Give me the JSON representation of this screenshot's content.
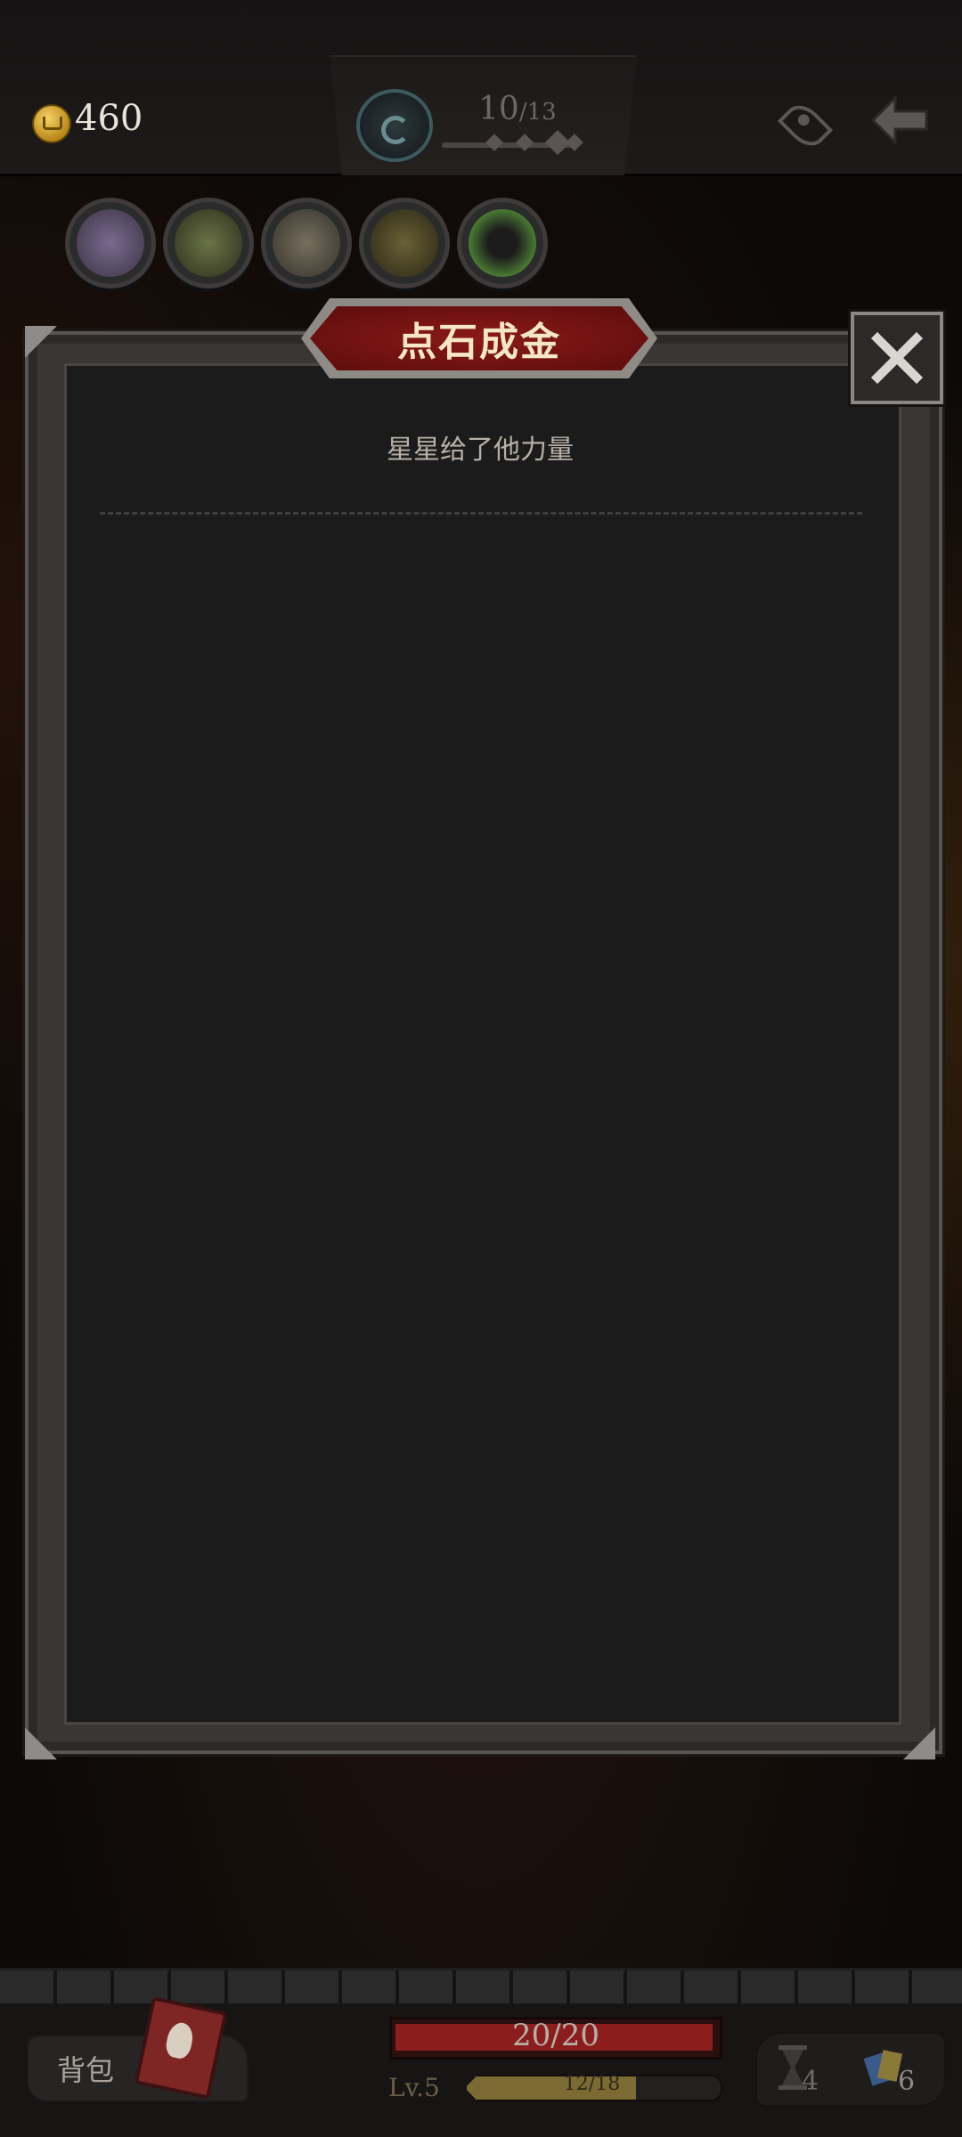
{
  "topbar": {
    "gold": "460",
    "stage_current": "10",
    "stage_total": "/13"
  },
  "relics": [
    {
      "icon": "cactus-relic-icon",
      "color": "#6a5a7a"
    },
    {
      "icon": "cannon-relic-icon",
      "color": "#545d3a"
    },
    {
      "icon": "monster-relic-icon",
      "color": "#5e5a50"
    },
    {
      "icon": "sunflower-relic-icon",
      "color": "#4d4a33"
    },
    {
      "icon": "green-orb-relic-icon",
      "color": "#33502a"
    }
  ],
  "modal": {
    "title": "点石成金",
    "subtitle": "星星给了他力量"
  },
  "bottom": {
    "bag_label": "背包",
    "hp": "20/20",
    "level": "Lv.5",
    "xp": "12/18",
    "xp_fraction": 0.667,
    "turns": "4",
    "cards": "6"
  },
  "colors": {
    "title_plate": "#8a1a18",
    "hp_fill": "#8b1e1c",
    "xp_fill": "#7c6a33",
    "gold": "#f6d266"
  }
}
